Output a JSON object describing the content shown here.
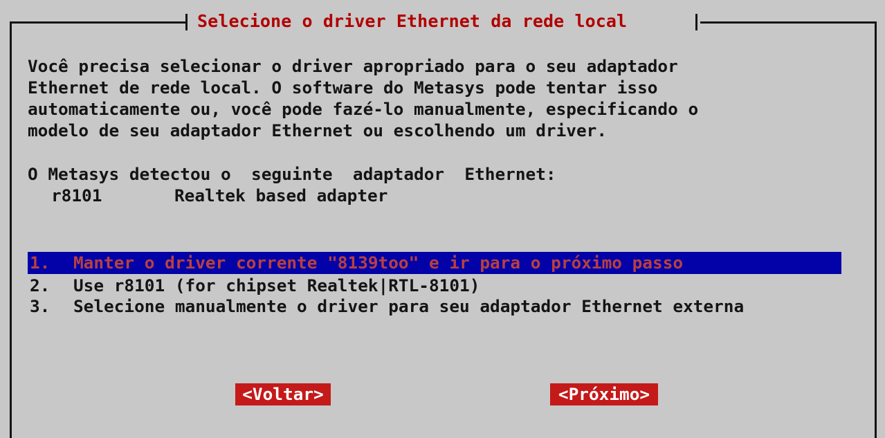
{
  "dialog": {
    "title": "Selecione o driver Ethernet da rede local"
  },
  "intro": {
    "lines": [
      "Você precisa selecionar o driver apropriado para o seu adaptador",
      "Ethernet de rede local. O software do Metasys pode tentar isso",
      "automaticamente ou, você pode fazé-lo manualmente, especificando o",
      "modelo de seu adaptador Ethernet ou escolhendo um driver."
    ]
  },
  "detected": {
    "label": "O Metasys detectou o  seguinte  adaptador  Ethernet:",
    "adapter_id": "r8101",
    "adapter_desc": "Realtek based adapter"
  },
  "options": [
    {
      "num": "1.",
      "label": "Manter o driver corrente \"8139too\" e ir para o próximo passo",
      "selected": true
    },
    {
      "num": "2.",
      "label": "Use r8101 (for chipset Realtek|RTL-8101)",
      "selected": false
    },
    {
      "num": "3.",
      "label": "Selecione manualmente o driver para seu adaptador Ethernet externa",
      "selected": false
    }
  ],
  "buttons": {
    "back_label": "<Voltar>",
    "next_label": "<Próximo>"
  },
  "colors": {
    "background": "#c8c8c8",
    "title_text": "#b20000",
    "selection_bar": "#0202a8",
    "button_bg": "#c41a1a",
    "button_text": "#ffffff"
  }
}
